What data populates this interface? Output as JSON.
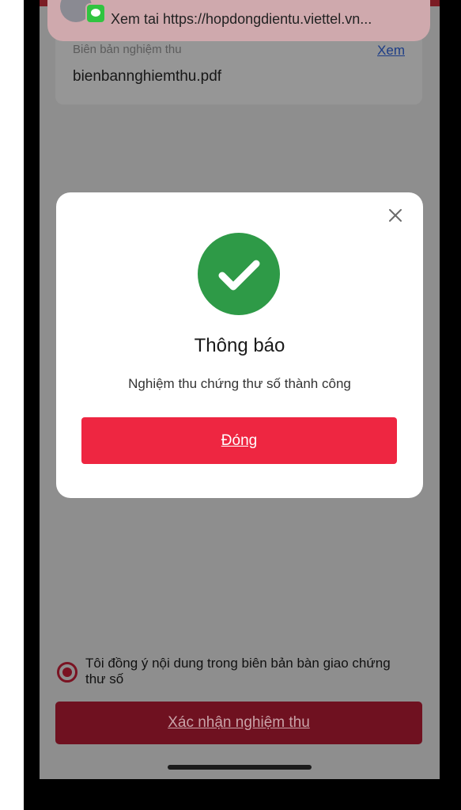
{
  "notification": {
    "text": "Xem tai https://hopdongdientu.viettel.vn..."
  },
  "document": {
    "label": "Biên bản nghiệm thu",
    "view_link": "Xem",
    "file_name": "bienbannghiemthu.pdf"
  },
  "modal": {
    "title": "Thông báo",
    "message": "Nghiệm thu chứng thư số thành công",
    "close_button": "Đóng"
  },
  "agreement": {
    "text": "Tôi đồng ý nội dung trong biên bản bàn giao chứng thư số",
    "checked": true
  },
  "confirm_button": "Xác nhận nghiệm thu",
  "colors": {
    "success": "#2e9a47",
    "primary": "#ee2641",
    "dimmed_primary": "#6f1120"
  }
}
